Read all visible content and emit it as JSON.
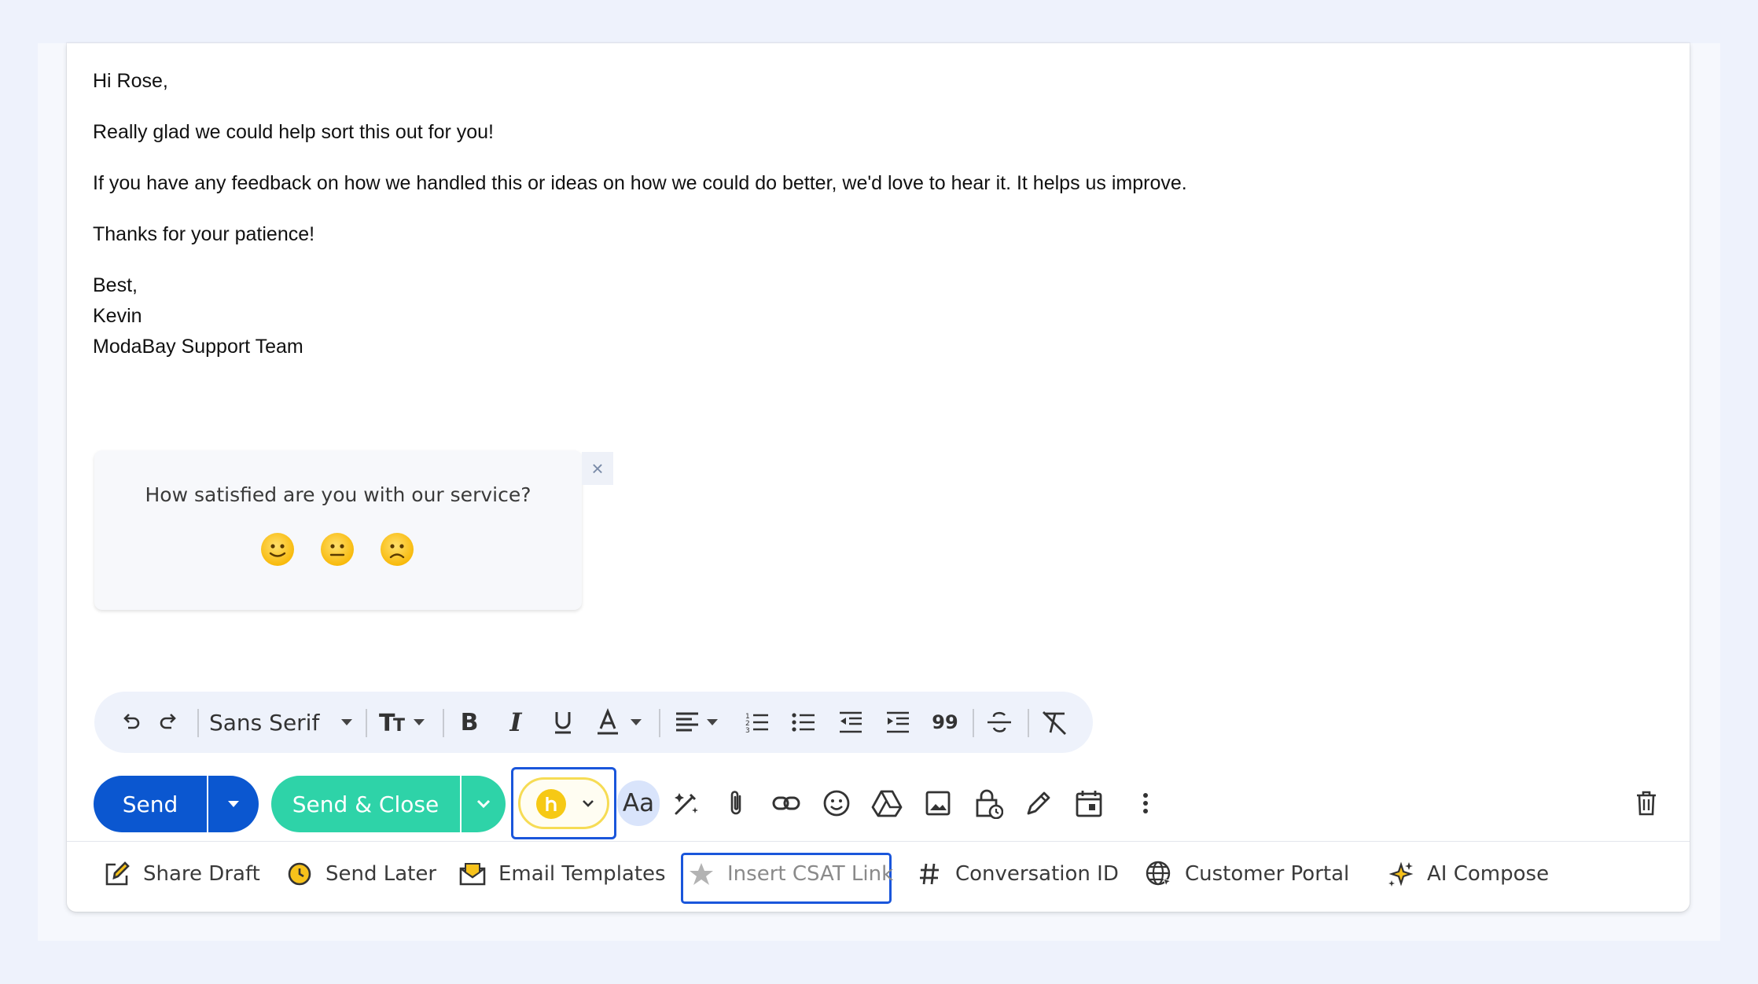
{
  "email": {
    "greeting": "Hi Rose,",
    "line1": "Really glad we could help sort this out for you!",
    "line2": "If you have any feedback on how we handled this or ideas on how we could do better, we'd love to hear it. It helps us improve.",
    "line3": "Thanks for your patience!",
    "signoff": "Best,",
    "name": "Kevin",
    "team": "ModaBay Support Team"
  },
  "csat": {
    "question": "How satisfied are you with our service?",
    "close_label": "×",
    "faces": [
      "happy-face-icon",
      "neutral-face-icon",
      "sad-face-icon"
    ]
  },
  "format_toolbar": {
    "font": "Sans Serif",
    "icons": [
      "undo-icon",
      "redo-icon",
      "font-size-icon",
      "bold-icon",
      "italic-icon",
      "underline-icon",
      "text-color-icon",
      "align-icon",
      "numbered-list-icon",
      "bulleted-list-icon",
      "indent-less-icon",
      "indent-more-icon",
      "quote-icon",
      "strikethrough-icon",
      "remove-formatting-icon"
    ]
  },
  "send_row": {
    "send": "Send",
    "send_close": "Send & Close",
    "aa": "Aa",
    "colors": {
      "send": "#0b57d0",
      "send_close": "#2ed3a8",
      "extension": "#f6c915"
    }
  },
  "actions": {
    "share_draft": "Share Draft",
    "send_later": "Send Later",
    "email_templates": "Email Templates",
    "insert_csat": "Insert CSAT Link",
    "conversation_id": "Conversation ID",
    "customer_portal": "Customer Portal",
    "ai_compose": "AI Compose"
  }
}
